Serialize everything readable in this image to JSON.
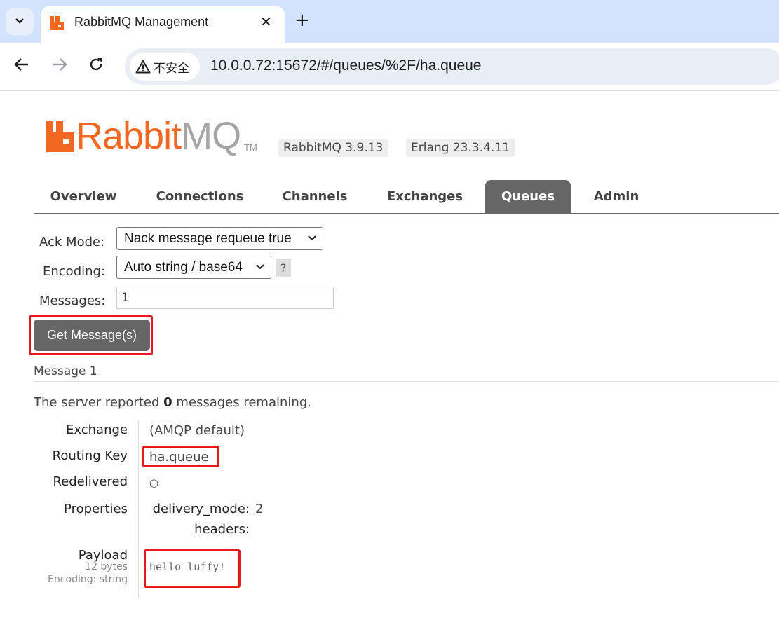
{
  "browser": {
    "tab_title": "RabbitMQ Management",
    "security_label": "不安全",
    "url": "10.0.0.72:15672/#/queues/%2F/ha.queue"
  },
  "header": {
    "logo_rabbit": "Rabbit",
    "logo_mq": "MQ",
    "logo_tm": "TM",
    "rabbitmq_version": "RabbitMQ 3.9.13",
    "erlang_version": "Erlang 23.3.4.11"
  },
  "nav": {
    "tabs": [
      {
        "label": "Overview"
      },
      {
        "label": "Connections"
      },
      {
        "label": "Channels"
      },
      {
        "label": "Exchanges"
      },
      {
        "label": "Queues",
        "active": true
      },
      {
        "label": "Admin"
      }
    ]
  },
  "get_form": {
    "ack_mode_label": "Ack Mode:",
    "ack_mode_value": "Nack message requeue true",
    "encoding_label": "Encoding:",
    "encoding_value": "Auto string / base64",
    "help_label": "?",
    "messages_label": "Messages:",
    "messages_value": "1",
    "submit_label": "Get Message(s)"
  },
  "message": {
    "heading": "Message 1",
    "report_prefix": "The server reported ",
    "remaining_count": "0",
    "report_suffix": " messages remaining.",
    "exchange_label": "Exchange",
    "exchange_value": "(AMQP default)",
    "routing_key_label": "Routing Key",
    "routing_key_value": "ha.queue",
    "redelivered_label": "Redelivered",
    "redelivered_value": "○",
    "properties_label": "Properties",
    "properties": [
      {
        "key": "delivery_mode:",
        "value": "2"
      },
      {
        "key": "headers:",
        "value": ""
      }
    ],
    "payload_label": "Payload",
    "payload_size": "12 bytes",
    "payload_encoding": "Encoding: string",
    "payload_value": "hello luffy!"
  },
  "colors": {
    "brand_orange": "#f26722",
    "highlight_red": "#e8171c",
    "nav_active": "#666666"
  }
}
